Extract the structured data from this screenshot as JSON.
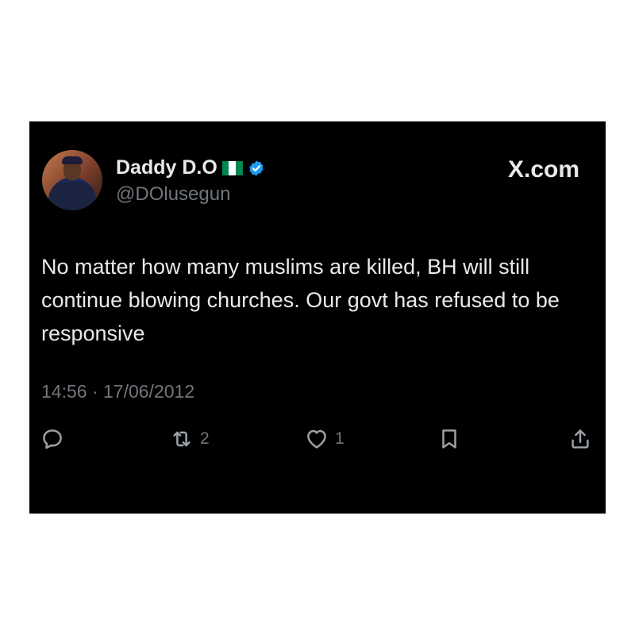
{
  "tweet": {
    "display_name": "Daddy D.O",
    "handle": "@DOlusegun",
    "verified": true,
    "flag": "nigeria-flag",
    "source_logo": "X.com",
    "text": "No matter how many muslims are killed, BH will still continue blowing churches. Our govt has refused to be responsive",
    "timestamp": "14:56 · 17/06/2012",
    "colors": {
      "background": "#000000",
      "text": "#e7e9ea",
      "muted": "#71767b",
      "verified": "#1d9bf0"
    }
  },
  "actions": {
    "reply_icon": "reply-icon",
    "retweet_icon": "retweet-icon",
    "retweet_count": "2",
    "like_icon": "heart-icon",
    "like_count": "1",
    "bookmark_icon": "bookmark-icon",
    "share_icon": "share-icon"
  }
}
